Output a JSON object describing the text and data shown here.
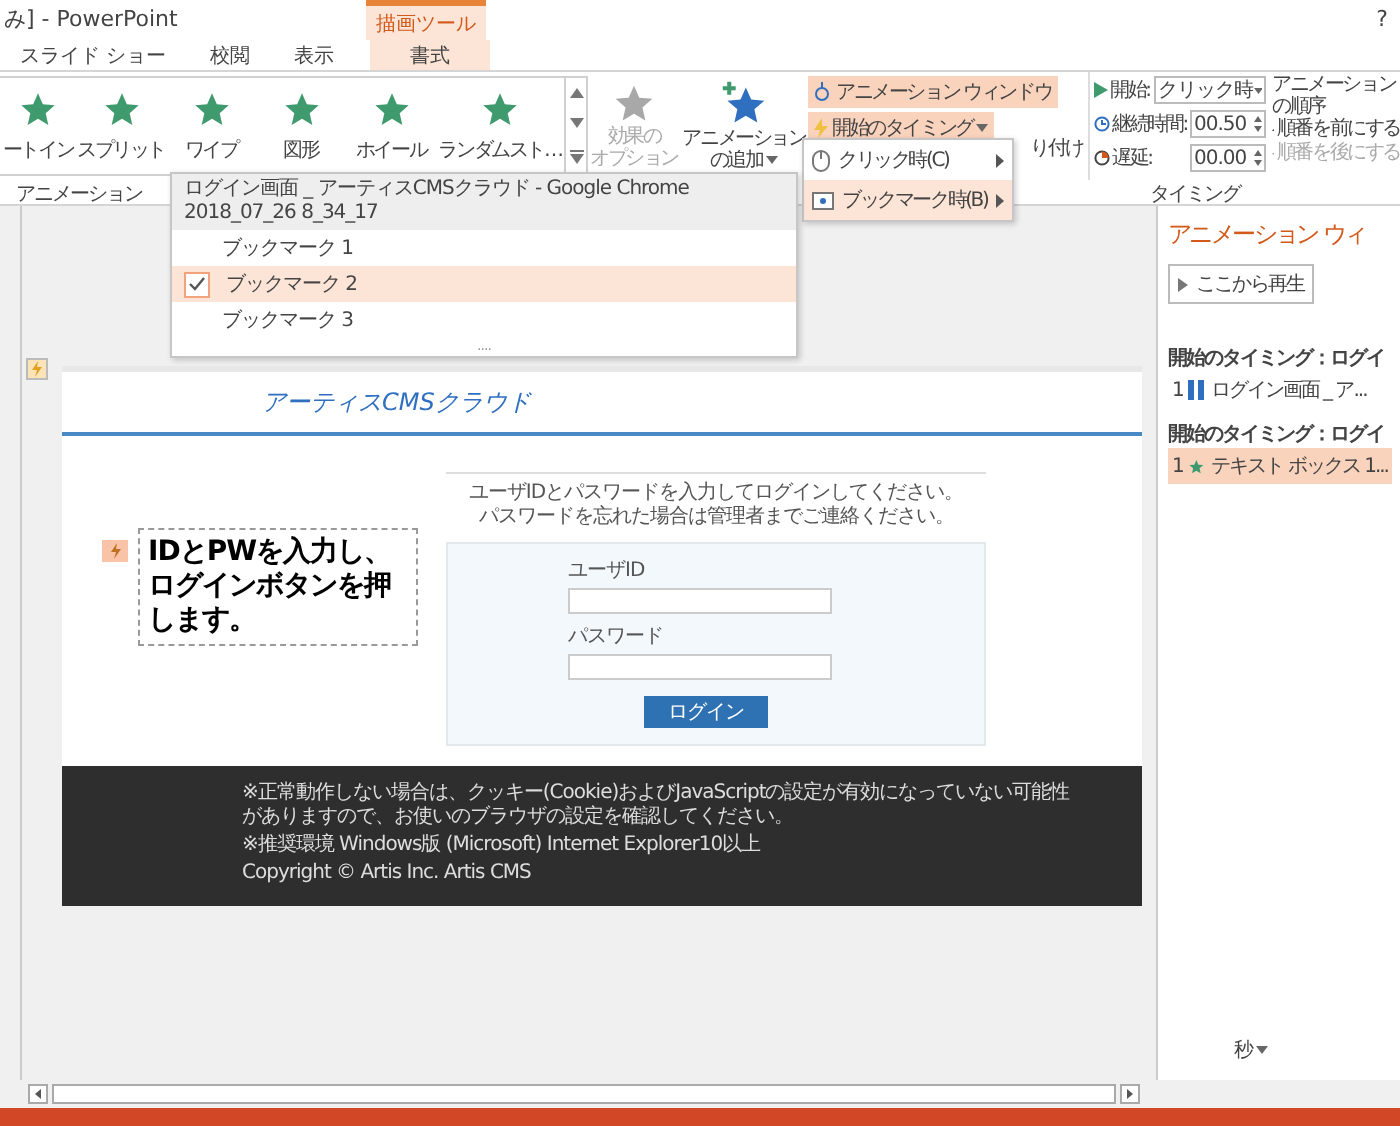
{
  "window": {
    "title": "み] - PowerPoint",
    "contextual_tab": "描画ツール",
    "help": "?"
  },
  "tabs": [
    {
      "label": "スライド ショー",
      "selected": false
    },
    {
      "label": "校閲",
      "selected": false
    },
    {
      "label": "表示",
      "selected": false
    },
    {
      "label": "書式",
      "selected": true
    }
  ],
  "gallery": [
    {
      "label": "ートイン"
    },
    {
      "label": "スプリット"
    },
    {
      "label": "ワイプ"
    },
    {
      "label": "図形"
    },
    {
      "label": "ホイール"
    },
    {
      "label": "ランダムスト…"
    }
  ],
  "effect_options": {
    "label_lines": [
      "効果の",
      "オプション"
    ],
    "disabled": true
  },
  "add_animation": {
    "label_lines": [
      "アニメーション",
      "の追加"
    ]
  },
  "advanced": [
    {
      "label": "アニメーション ウィンドウ",
      "highlighted": true
    },
    {
      "label": "開始のタイミング",
      "highlighted": true
    }
  ],
  "paste_fragment": "り付け",
  "timing": {
    "start_label": "開始:",
    "start_value": "クリック時",
    "duration_label": "継続時間:",
    "duration": "00.50",
    "delay_label": "遅延:",
    "delay": "00.00",
    "reorder_title": "アニメーションの順序",
    "move_earlier": {
      "label": "順番を前にする",
      "disabled": false
    },
    "move_later": {
      "label": "順番を後にする",
      "disabled": true
    }
  },
  "group_labels": {
    "animation": "アニメーション",
    "timing": "タイミング"
  },
  "trigger_menu": [
    {
      "label": "クリック時(C)",
      "selected": false
    },
    {
      "label": "ブックマーク時(B)",
      "selected": true
    }
  ],
  "bookmark_menu": {
    "title": "ログイン画面 _ アーティスCMSクラウド - Google Chrome 2018_07_26 8_34_17",
    "items": [
      {
        "label": "ブックマーク 1",
        "checked": false
      },
      {
        "label": "ブックマーク 2",
        "checked": true
      },
      {
        "label": "ブックマーク 3",
        "checked": false
      }
    ],
    "more": "...."
  },
  "slide": {
    "logo": "アーティスCMSクラウド",
    "instructions": [
      "ユーザIDとパスワードを入力してログインしてください。",
      "パスワードを忘れた場合は管理者までご連絡ください。"
    ],
    "user_id_label": "ユーザID",
    "password_label": "パスワード",
    "login_button": "ログイン",
    "callout": "IDとPWを入力し、ログインボタンを押します。",
    "footer": [
      "※正常動作しない場合は、クッキー(Cookie)およびJavaScriptの設定が有効になっていない可能性がありますので、お使いのブラウザの設定を確認してください。",
      "※推奨環境 Windows版 (Microsoft) Internet Explorer10以上",
      "Copyright © Artis Inc. Artis CMS"
    ]
  },
  "animation_pane": {
    "title": "アニメーション ウィ",
    "play_button": "ここから再生",
    "groups": [
      {
        "header": "開始のタイミング：ログイ",
        "items": [
          {
            "number": "1",
            "kind": "pause",
            "label": "ログイン画面 _ ア...",
            "selected": false
          }
        ]
      },
      {
        "header": "開始のタイミング：ログイ",
        "items": [
          {
            "number": "1",
            "kind": "star",
            "label": "テキスト ボックス 1...",
            "selected": true
          }
        ]
      }
    ]
  },
  "time_unit": "秒"
}
